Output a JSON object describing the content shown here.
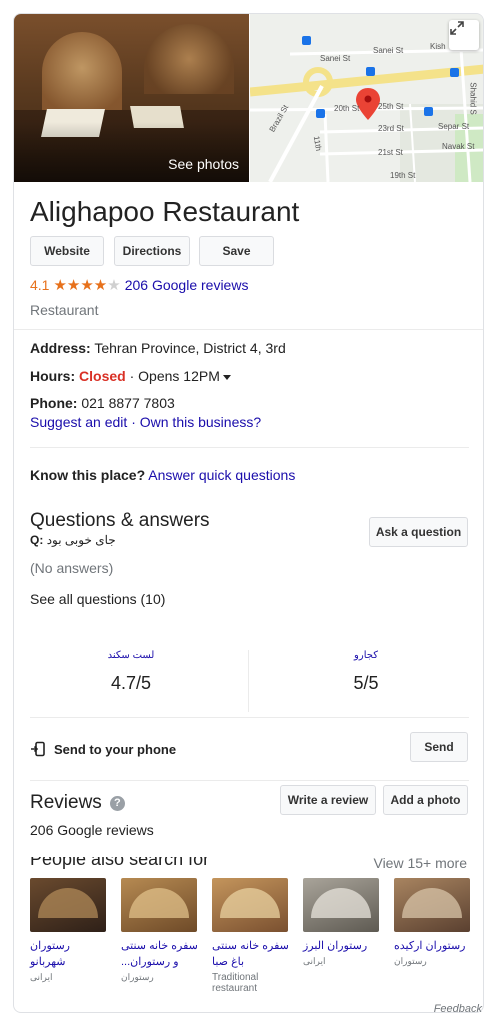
{
  "media": {
    "see_photos": "See photos",
    "map_labels": {
      "sanei_1": "Sanei St",
      "sanei_2": "Sanei St",
      "kish": "Kish",
      "street_20": "20th St",
      "street_25": "25th St",
      "street_23": "23rd St",
      "street_21": "21st St",
      "street_19": "19th St",
      "street_11": "11th",
      "brazil": "Brazil St",
      "separ": "Separ St",
      "navak": "Navak St",
      "shahid": "Shahid S"
    }
  },
  "title": "Alighapoo Restaurant",
  "actions": {
    "website": "Website",
    "directions": "Directions",
    "save": "Save"
  },
  "rating": {
    "value": "4.1",
    "stars": 4.1,
    "reviews_link": "206 Google reviews"
  },
  "category": "Restaurant",
  "address": {
    "label": "Address:",
    "value": "Tehran Province, District 4, 3rd"
  },
  "hours": {
    "label": "Hours:",
    "status": "Closed",
    "opens": "· Opens 12PM"
  },
  "phone": {
    "label": "Phone:",
    "value": "021 8877 7803"
  },
  "edit_links": {
    "suggest": "Suggest an edit",
    "sep": "·",
    "own": "Own this business?"
  },
  "know": {
    "label": "Know this place?",
    "link": "Answer quick questions"
  },
  "qa": {
    "heading": "Questions & answers",
    "ask_button": "Ask a question",
    "question_prefix": "Q:",
    "question_text": "جای خوبی بود",
    "no_answers": "(No answers)",
    "see_all": "See all questions (10)"
  },
  "stats": [
    {
      "name": "لست سکند",
      "value": "4.7/5"
    },
    {
      "name": "کجارو",
      "value": "5/5"
    }
  ],
  "send": {
    "label": "Send to your phone",
    "button": "Send"
  },
  "reviews": {
    "heading": "Reviews",
    "write": "Write a review",
    "add_photo": "Add a photo",
    "link": "206 Google reviews"
  },
  "people_also_search": {
    "title": "People also search for",
    "more": "View 15+ more",
    "items": [
      {
        "name": "رستوران شهربانو",
        "sub": "ایرانی",
        "tone": "#7a5a3e"
      },
      {
        "name": "سفره خانه سنتی و رستوران...",
        "sub": "رستوران",
        "tone": "#a37b4f"
      },
      {
        "name": "سفره خانه سنتی باغ صبا",
        "sub": "Traditional restaurant",
        "tone": "#b08654"
      },
      {
        "name": "رستوران البرز",
        "sub": "ایرانی",
        "tone": "#8d8a80"
      },
      {
        "name": "رستوران ارکیده",
        "sub": "رستوران",
        "tone": "#9a7a5a"
      }
    ]
  },
  "feedback": "Feedback",
  "colors": {
    "rating": "#e7711b",
    "link": "#1a0dab",
    "closed": "#d93025",
    "map_pin": "#ea4335",
    "highway": "#f4e28a"
  }
}
